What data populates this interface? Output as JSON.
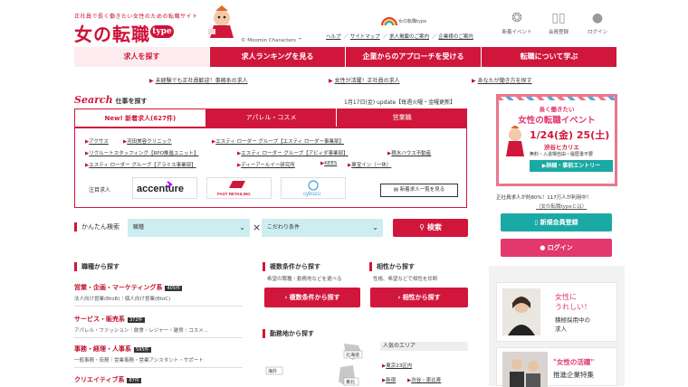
{
  "header": {
    "tagline": "正社員で長く働きたい女性のための転職サイト",
    "logo": "女の転職",
    "logo_badge": "type",
    "copyright": "© Moomin Characters ™",
    "badge_text": "女の転職type",
    "links": [
      "ヘルプ",
      "サイトマップ",
      "求人掲載のご案内",
      "企業様のご案内"
    ],
    "icons": [
      {
        "label": "新着イベント",
        "icon": "chat-icon"
      },
      {
        "label": "会員登録",
        "icon": "book-icon"
      },
      {
        "label": "ログイン",
        "icon": "person-icon"
      }
    ]
  },
  "nav": {
    "items": [
      "求人を探す",
      "求人ランキングを見る",
      "企業からのアプローチを受ける",
      "転職について学ぶ"
    ]
  },
  "alerts": [
    "未経験でも正社員歓迎！事務系の求人",
    "女性が活躍！正社員の求人",
    "あなたが働き方を探す"
  ],
  "search": {
    "title_en": "Search",
    "title_jp": "仕事を探す",
    "update": "1月17日(金) update【毎週火曜・金曜更新】",
    "tabs": [
      "New! 新着求人(627件)",
      "アパレル・コスメ",
      "営業職"
    ],
    "job_links": [
      [
        "アクサス",
        "河田美容クリニック",
        "エスティ ローダー グループ【エスティ ローダー事業部】"
      ],
      [
        "リクルートスタッフィング【RPO推進ユニット】",
        "エスティ ローダー グループ【アビィダ事業部】",
        "積水ハウス不動産"
      ],
      [
        "エスティ ローダー グループ【アラミス事業部】",
        "ディーアールイー研究所",
        "KEES",
        "東宝イン（一休）"
      ]
    ],
    "featured_label": "注目求人",
    "featured_logos": [
      "accenture",
      "FAST RETAILING",
      "cybozu"
    ],
    "all_jobs": "新着求人一覧を見る"
  },
  "easy_search": {
    "label": "かんたん検索",
    "job_placeholder": "職種",
    "condition_placeholder": "こだわり条件",
    "separator": "×",
    "button": "検索"
  },
  "by_job": {
    "heading": "職種から探す",
    "categories": [
      {
        "name": "営業・企画・マーケティング系",
        "count": "405件",
        "sub": "法人向け営業(BtoB)｜個人向け営業(BtoC)"
      },
      {
        "name": "サービス・販売系",
        "count": "372件",
        "sub": "アパレル・ファッション｜飲食・レジャー・雑貨｜コスメ…"
      },
      {
        "name": "事務・経理・人事系",
        "count": "595件",
        "sub": "一般事務・庶務｜営業事務・営業アシスタント・サポート"
      },
      {
        "name": "クリエイティブ系",
        "count": "87件",
        "sub": ""
      }
    ]
  },
  "by_conditions": {
    "heading": "複数条件から探す",
    "desc": "希望の職種・勤務地などを選べる",
    "button": "複数条件から探す"
  },
  "by_compat": {
    "heading": "相性から探す",
    "desc": "性格、希望などで相性を診断",
    "button": "相性から探す"
  },
  "by_location": {
    "heading": "勤務地から探す",
    "popular_label": "人気のエリア",
    "popular": [
      "東京23区内",
      "新宿",
      "渋谷・恵比寿"
    ],
    "map_labels": [
      "北海道",
      "東北",
      "海外"
    ]
  },
  "sidebar": {
    "event": {
      "line1": "長く働きたい",
      "line2": "女性の転職イベント",
      "date": "1/24(金) 25(土)",
      "venue": "渋谷ヒカリエ",
      "note": "無料・入退場自由・履歴書不要",
      "cta": "▶詳細・事前エントリー"
    },
    "member_text": "正社員求人が約80%！117万人が利用中！",
    "member_link": "（女の転職typeとは）",
    "register": "新規会員登録",
    "login": "ログイン",
    "promo1": {
      "line1": "女性に",
      "line2": "うれしい！",
      "line3": "積極採用中の",
      "line4": "求人"
    },
    "promo2": {
      "line1": "\"女性の活躍\"",
      "line2": "推進企業特集"
    }
  },
  "colors": {
    "brand": "#d0173b",
    "teal": "#1aa9a4",
    "pink": "#e2386e",
    "light_teal": "#cdeef0"
  }
}
